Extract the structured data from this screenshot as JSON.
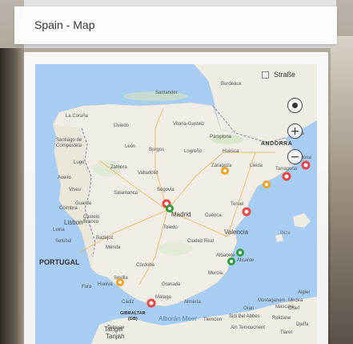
{
  "card": {
    "title": "Spain - Map"
  },
  "map": {
    "type_toggle_label": "Straße",
    "controls": {
      "locate_icon": "target-icon",
      "zoom_in": "+",
      "zoom_out": "−"
    },
    "country_labels": {
      "portugal": "PORTUGAL",
      "andorra": "ANDORRA"
    },
    "place_labels": [
      "Bordeaux",
      "Santander",
      "La Coruña",
      "Oviedo",
      "Vitoria-Gasteiz",
      "Pamplona",
      "Santiago de Compostela",
      "León",
      "Burgos",
      "Logroño",
      "Huesca",
      "Girona",
      "Lugo",
      "Zamora",
      "Valladolid",
      "Zaragoza",
      "Lleida",
      "Barcelona",
      "Aveiro",
      "Viseu",
      "Salamanca",
      "Segovia",
      "Tarragona",
      "Madrid",
      "Guarda",
      "Coimbra",
      "Castelo Branco",
      "Toledo",
      "Cuenca",
      "Teruel",
      "Leiria",
      "Lisbon",
      "Badajoz",
      "Ciudad Real",
      "Valencia",
      "Ibiza",
      "Setúbal",
      "Mérida",
      "Albacete",
      "Córdoba",
      "Murcia",
      "Alicante",
      "Faro",
      "Huelva",
      "Sevilla",
      "Granada",
      "Almería",
      "Cádiz",
      "Málaga",
      "GIBRALTAR (GB)",
      "Tanger",
      "Tanjah",
      "Tetouan",
      "Alborán Meer",
      "Oran",
      "Algier",
      "Tlemcen",
      "Medea",
      "Sidi Bel Abbès",
      "Mascara",
      "Relizane",
      "Chlef",
      "Mostaganem",
      "Ain Temouchent",
      "Djelfa",
      "Tiaret"
    ]
  }
}
